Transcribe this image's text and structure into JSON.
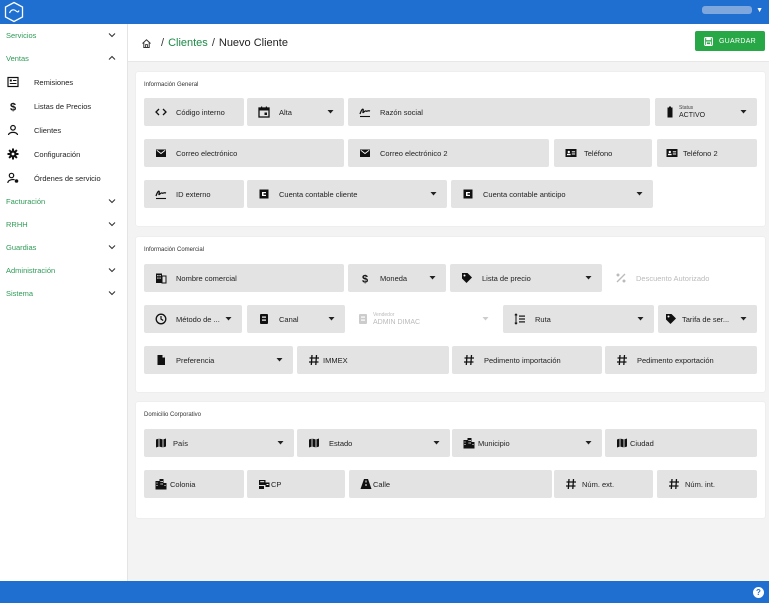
{
  "topbar": {
    "user_name": ""
  },
  "sidebar": {
    "groups": [
      {
        "label": "Servicios",
        "expanded": false
      },
      {
        "label": "Ventas",
        "expanded": true,
        "items": [
          {
            "label": "Remisiones",
            "icon": "list-doc-icon"
          },
          {
            "label": "Listas de Precios",
            "icon": "dollar-icon"
          },
          {
            "label": "Clientes",
            "icon": "person-icon"
          },
          {
            "label": "Configuración",
            "icon": "gear-icon"
          },
          {
            "label": "Órdenes de servicio",
            "icon": "person-settings-icon"
          }
        ]
      },
      {
        "label": "Facturación",
        "expanded": false
      },
      {
        "label": "RRHH",
        "expanded": false
      },
      {
        "label": "Guardias",
        "expanded": false
      },
      {
        "label": "Administración",
        "expanded": false
      },
      {
        "label": "Sistema",
        "expanded": false
      }
    ]
  },
  "breadcrumb": {
    "section": "Clientes",
    "separator": "/",
    "current": "Nuevo Cliente",
    "root_separator": "/"
  },
  "actions": {
    "save_label": "GUARDAR"
  },
  "colors": {
    "accent": "#27a745",
    "topbar": "#1f6fd1",
    "link": "#1d8a48"
  },
  "general": {
    "title": "Información General",
    "codigo_interno": "Código interno",
    "alta": "Alta",
    "razon_social": "Razón social",
    "status_label": "Status",
    "status_value": "ACTIVO",
    "correo": "Correo electrónico",
    "correo2": "Correo electrónico 2",
    "telefono": "Teléfono",
    "telefono2": "Teléfono 2",
    "id_externo": "ID externo",
    "cuenta_cliente": "Cuenta contable cliente",
    "cuenta_anticipo": "Cuenta contable anticipo"
  },
  "comercial": {
    "title": "Información Comercial",
    "nombre_comercial": "Nombre comercial",
    "moneda": "Moneda",
    "lista_precio": "Lista de precio",
    "descuento": "Descuento Autorizado",
    "metodo": "Método de ...",
    "canal": "Canal",
    "vendedor_label": "Vendedor",
    "vendedor_value": "ADMIN DIMAC",
    "ruta": "Ruta",
    "tarifa": "Tarifa de ser...",
    "preferencia": "Preferencia",
    "immex": "IMMEX",
    "pedimento_import": "Pedimento importación",
    "pedimento_export": "Pedimento exportación"
  },
  "domicilio": {
    "title": "Domicilio Corporativo",
    "pais": "País",
    "estado": "Estado",
    "municipio": "Municipio",
    "ciudad": "Ciudad",
    "colonia": "Colonia",
    "cp": "CP",
    "calle": "Calle",
    "num_ext": "Núm. ext.",
    "num_int": "Núm. int."
  }
}
